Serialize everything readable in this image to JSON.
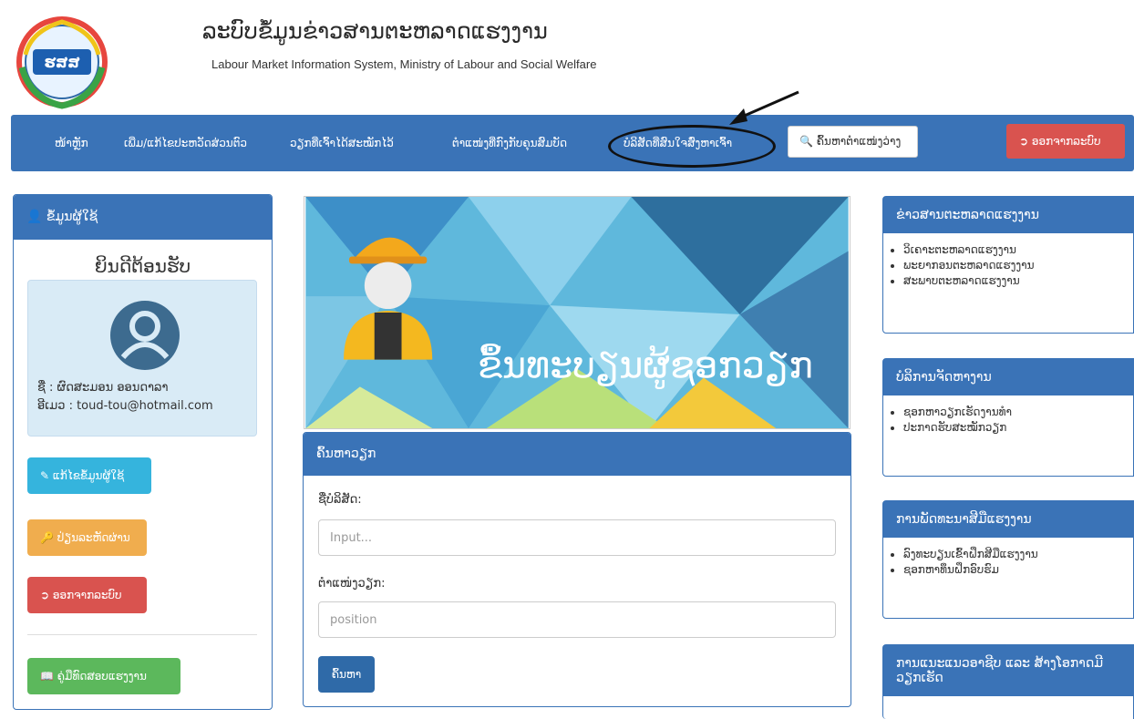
{
  "header": {
    "title_lo": "ລະບົບຂໍ້ມູນຂ່າວສານຕະຫລາດແຮງງານ",
    "title_en": "Labour Market Information System, Ministry of Labour and Social Welfare",
    "logo_text": "ຮສສ"
  },
  "nav": {
    "items": [
      {
        "label": "ໜ້າຫຼັກ"
      },
      {
        "label": "ເພີ່ມ/ແກ້ໄຂປະຫວັດສ່ວນຕົວ"
      },
      {
        "label": "ວຽກທີ່ເຈົ້າໄດ້ສະໝັກໄວ້"
      },
      {
        "label": "ຕໍາແໜ່ງທີ່ກົງກັບຄຸນສົມບັດ"
      },
      {
        "label": "ບໍລິສັດທີ່ສົນໃຈສົ່ງຫາເຈົ້າ"
      }
    ],
    "search_label": "ຄົ້ນຫາຕໍາແໜ່ງວ່າງ",
    "logout_label": "ອອກຈາກລະບົບ"
  },
  "user_panel": {
    "heading": "ຂໍ້ມູນຜູ້ໃຊ້",
    "welcome": "ຍິນດີຕ້ອນຮັບ",
    "name_line": "ຊື່ : ຜົດສະມອນ ອອນດາລາ",
    "email_line": "ອີເມວ : toud-tou@hotmail.com",
    "edit_label": "ແກ້ໄຂຂໍ້ມູນຜູ້ໃຊ້",
    "password_label": "ປ່ຽນລະຫັດຜ່ານ",
    "logout_label": "ອອກຈາກລະບົບ",
    "manual_label": "ຄູ່ມືທົດສອບແຮງງານ"
  },
  "banner": {
    "text": "ຂຶ້ນທະບຽນຜູ້ຊອກວຽກ"
  },
  "search_panel": {
    "heading": "ຄົ້ນຫາວຽກ",
    "company_label": "ຊື່ບໍລິສັດ:",
    "company_placeholder": "Input...",
    "position_label": "ຕໍາແໜ່ງວຽກ:",
    "position_placeholder": "position",
    "button_label": "ຄົ້ນຫາ"
  },
  "right_panels": [
    {
      "heading": "ຂ່າວສານຕະຫລາດແຮງງານ",
      "items": [
        "ວິເຄາະຕະຫລາດແຮງງານ",
        "ພະຍາກອນຕະຫລາດແຮງງານ",
        "ສະພາບຕະຫລາດແຮງງານ"
      ]
    },
    {
      "heading": "ບໍລິການຈັດຫາງານ",
      "items": [
        "ຊອກຫາວຽກເຮັດງານທໍາ",
        "ປະກາດຮັບສະໝັກວຽກ"
      ]
    },
    {
      "heading": "ການພັດທະນາສີມືແຮງງານ",
      "items": [
        "ລົງທະບຽນເຂົ້າຝຶກສີມືແຮງງານ",
        "ຊອກຫາທຶນຝຶກອົບຮົມ"
      ]
    },
    {
      "heading": "ການແນະແນວອາຊີບ ແລະ ສ້າງໂອກາດມີວຽກເຮັດ",
      "items": []
    }
  ],
  "colors": {
    "primary": "#3a73b7",
    "danger": "#d9534f",
    "warning": "#f0ad4e",
    "info": "#35b4dd",
    "success": "#5cb85c"
  },
  "icons": [
    "user-icon",
    "search-icon",
    "logout-icon",
    "pencil-icon",
    "key-icon",
    "book-icon",
    "arrow-annotation"
  ]
}
